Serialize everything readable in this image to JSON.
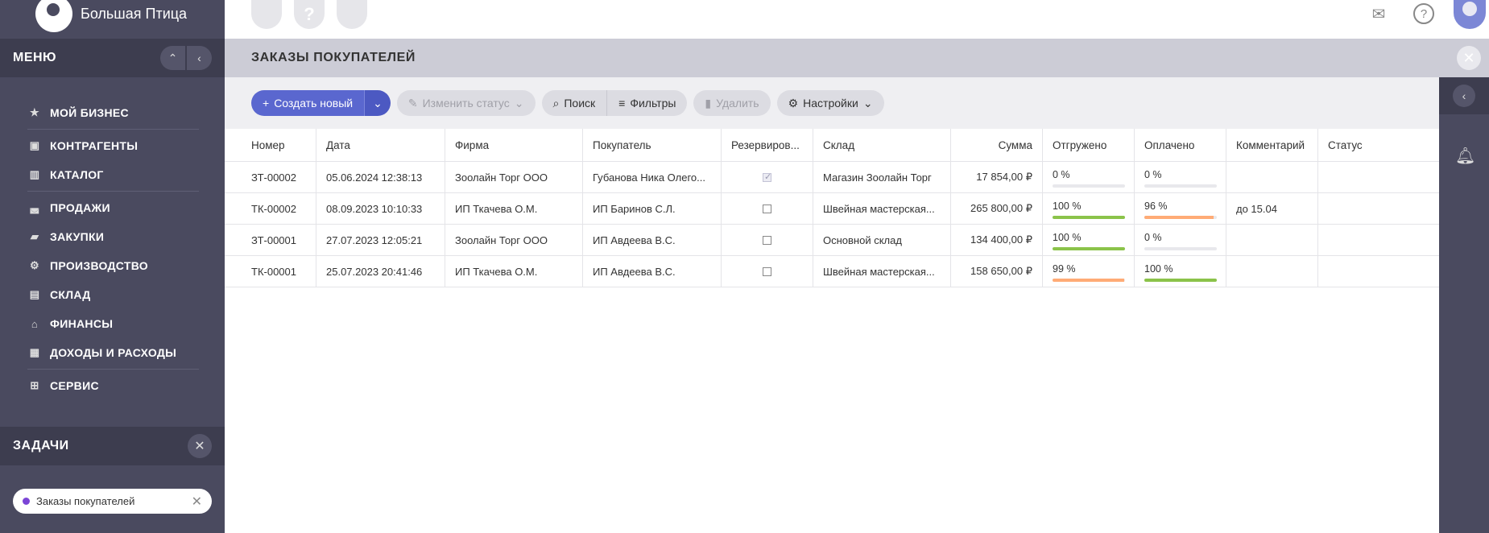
{
  "brand": {
    "name": "Большая Птица"
  },
  "menu": {
    "title": "МЕНЮ",
    "items": [
      {
        "label": "МОЙ БИЗНЕС",
        "icon": "star-icon",
        "glyph": "★"
      },
      {
        "label": "КОНТРАГЕНТЫ",
        "icon": "briefcase-icon",
        "glyph": "▣"
      },
      {
        "label": "КАТАЛОГ",
        "icon": "book-icon",
        "glyph": "▥"
      },
      {
        "label": "ПРОДАЖИ",
        "icon": "basket-icon",
        "glyph": "◛"
      },
      {
        "label": "ЗАКУПКИ",
        "icon": "truck-icon",
        "glyph": "▰"
      },
      {
        "label": "ПРОИЗВОДСТВО",
        "icon": "robot-arm-icon",
        "glyph": "⚙"
      },
      {
        "label": "СКЛАД",
        "icon": "warehouse-icon",
        "glyph": "▤"
      },
      {
        "label": "ФИНАНСЫ",
        "icon": "bank-icon",
        "glyph": "⌂"
      },
      {
        "label": "ДОХОДЫ И РАСХОДЫ",
        "icon": "wallet-icon",
        "glyph": "▦"
      },
      {
        "label": "СЕРВИС",
        "icon": "service-icon",
        "glyph": "⊞"
      }
    ]
  },
  "tasks": {
    "title": "ЗАДАЧИ",
    "items": [
      {
        "label": "Заказы покупателей"
      }
    ]
  },
  "page": {
    "title": "ЗАКАЗЫ ПОКУПАТЕЛЕЙ"
  },
  "toolbar": {
    "create": "Создать новый",
    "change_status": "Изменить статус",
    "search": "Поиск",
    "filters": "Фильтры",
    "delete": "Удалить",
    "settings": "Настройки"
  },
  "table": {
    "columns": [
      "Номер",
      "Дата",
      "Фирма",
      "Покупатель",
      "Резервиров...",
      "Склад",
      "Сумма",
      "Отгружено",
      "Оплачено",
      "Комментарий",
      "Статус"
    ],
    "rows": [
      {
        "number": "ЗТ-00002",
        "date": "05.06.2024 12:38:13",
        "firm": "Зоолайн Торг ООО",
        "buyer": "Губанова Ника Олего...",
        "reserved": true,
        "warehouse": "Магазин Зоолайн Торг",
        "sum": "17 854,00 ₽",
        "shipped": "0 %",
        "shipped_pct": 0,
        "shipped_color": "#8bc34a",
        "paid": "0 %",
        "paid_pct": 0,
        "paid_color": "#8bc34a",
        "comment": "",
        "status": ""
      },
      {
        "number": "ТК-00002",
        "date": "08.09.2023 10:10:33",
        "firm": "ИП Ткачева О.М.",
        "buyer": "ИП Баринов С.Л.",
        "reserved": false,
        "warehouse": "Швейная мастерская...",
        "sum": "265 800,00 ₽",
        "shipped": "100 %",
        "shipped_pct": 100,
        "shipped_color": "#8bc34a",
        "paid": "96 %",
        "paid_pct": 96,
        "paid_color": "#ffab76",
        "comment": "до 15.04",
        "status": ""
      },
      {
        "number": "ЗТ-00001",
        "date": "27.07.2023 12:05:21",
        "firm": "Зоолайн Торг ООО",
        "buyer": "ИП Авдеева В.С.",
        "reserved": false,
        "warehouse": "Основной склад",
        "sum": "134 400,00 ₽",
        "shipped": "100 %",
        "shipped_pct": 100,
        "shipped_color": "#8bc34a",
        "paid": "0 %",
        "paid_pct": 0,
        "paid_color": "#8bc34a",
        "comment": "",
        "status": ""
      },
      {
        "number": "ТК-00001",
        "date": "25.07.2023 20:41:46",
        "firm": "ИП Ткачева О.М.",
        "buyer": "ИП Авдеева В.С.",
        "reserved": false,
        "warehouse": "Швейная мастерская...",
        "sum": "158 650,00 ₽",
        "shipped": "99 %",
        "shipped_pct": 99,
        "shipped_color": "#ffab76",
        "paid": "100 %",
        "paid_pct": 100,
        "paid_color": "#8bc34a",
        "comment": "",
        "status": ""
      }
    ]
  },
  "colors": {
    "sidebar": "#4a4a5f",
    "accent": "#5a67cf",
    "header": "#ccccd6"
  }
}
